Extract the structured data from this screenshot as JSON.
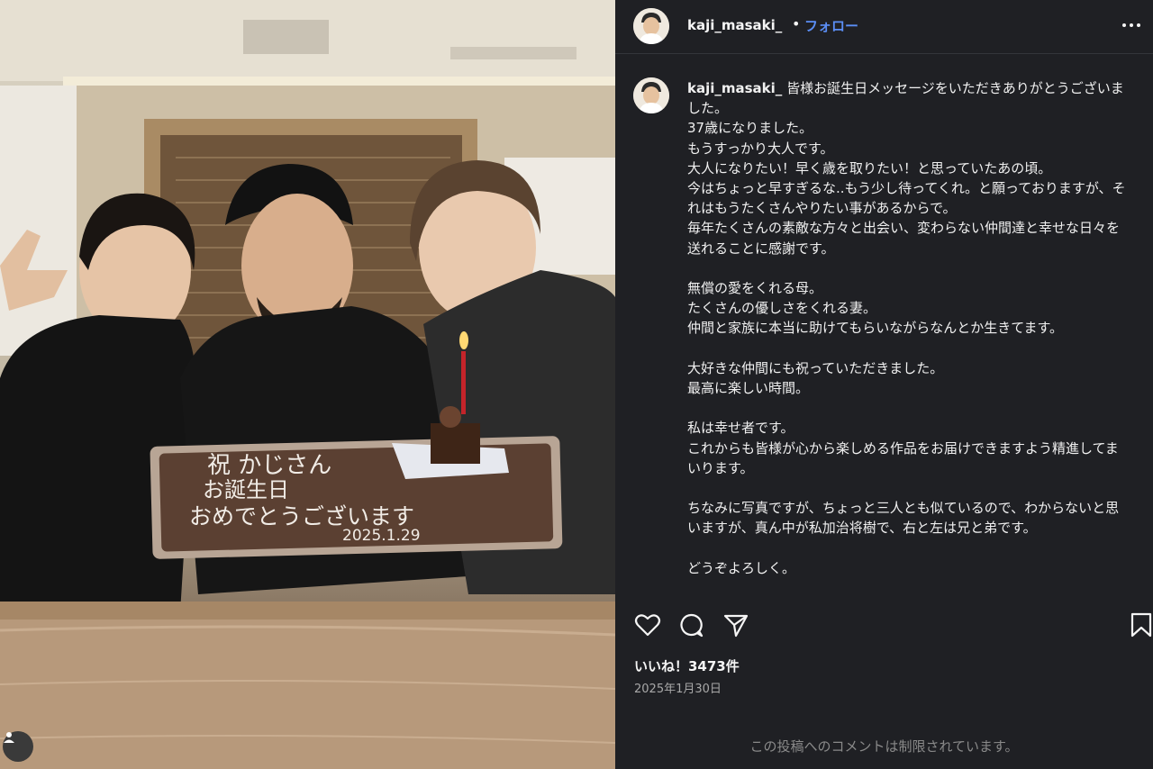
{
  "photo": {
    "board_text_line1": "祝 かじさん",
    "board_text_line2": "お誕生日",
    "board_text_line3": "おめでとうございます",
    "board_date": "2025.1.29",
    "tag_icon": "person-icon"
  },
  "header": {
    "username": "kaji_masaki_",
    "separator": "•",
    "follow_label": "フォロー",
    "more_icon": "more-horizontal-icon"
  },
  "caption": {
    "username": "kaji_masaki_",
    "text": "皆様お誕生日メッセージをいただきありがとうございました。\n37歳になりました。\nもうすっかり大人です。\n大人になりたい！早く歳を取りたい！と思っていたあの頃。\n今はちょっと早すぎるな..もう少し待ってくれ。と願っておりますが、それはもうたくさんやりたい事があるからで。\n毎年たくさんの素敵な方々と出会い、変わらない仲間達と幸せな日々を送れることに感謝です。\n\n無償の愛をくれる母。\nたくさんの優しさをくれる妻。\n仲間と家族に本当に助けてもらいながらなんとか生きてます。\n\n大好きな仲間にも祝っていただきました。\n最高に楽しい時間。\n\n私は幸せ者です。\nこれからも皆様が心から楽しめる作品をお届けできますよう精進してまいります。\n\nちなみに写真ですが、ちょっと三人とも似ているので、わからないと思いますが、真ん中が私加治将樹で、右と左は兄と弟です。\n\nどうぞよろしく。"
  },
  "actions": {
    "like_icon": "heart-icon",
    "comment_icon": "comment-icon",
    "share_icon": "send-icon",
    "save_icon": "bookmark-icon"
  },
  "likes": "いいね！3473件",
  "date": "2025年1月30日",
  "comments_notice": "この投稿へのコメントは制限されています。",
  "colors": {
    "panel_bg": "#1f2024",
    "accent": "#5b8ef5",
    "muted": "#a8a8a8"
  }
}
